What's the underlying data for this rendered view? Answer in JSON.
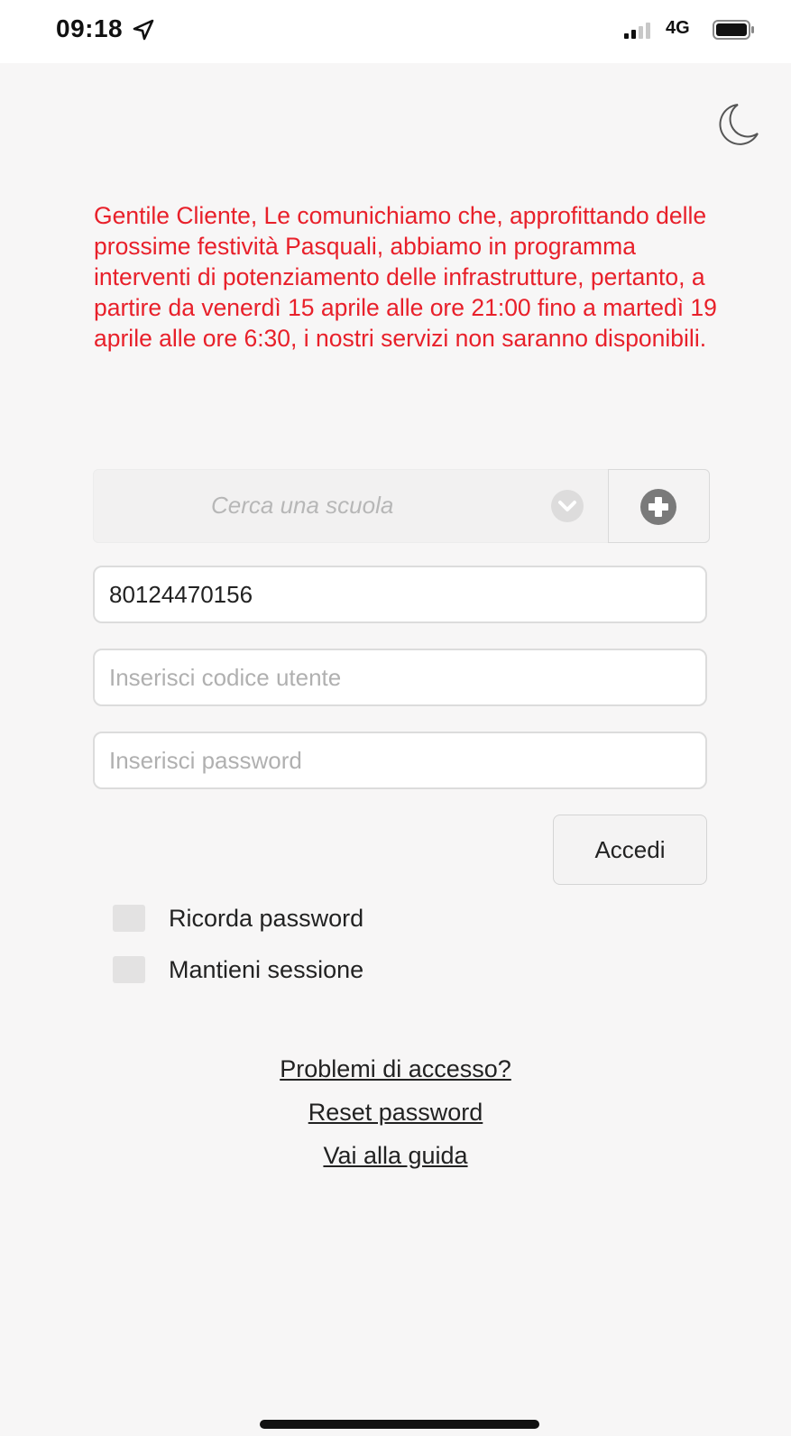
{
  "status_bar": {
    "time": "09:18",
    "network": "4G",
    "icons": [
      "location-arrow-icon",
      "signal-bars-icon",
      "battery-icon"
    ]
  },
  "header": {
    "night_mode_icon": "moon-icon"
  },
  "notice": {
    "text": "Gentile Cliente, Le comunichiamo che, approfittando delle prossime festività Pasquali, abbiamo in programma interventi di potenziamento delle infrastrutture, pertanto, a partire da venerdì 15 aprile alle ore 21:00 fino a martedì 19 aprile alle ore 6:30, i nostri servizi non saranno disponibili.",
    "color": "#e8202a"
  },
  "school_search": {
    "placeholder": "Cerca una scuola",
    "dropdown_icon": "chevron-down-icon",
    "add_icon": "plus-circle-icon"
  },
  "form": {
    "school_code_value": "80124470156",
    "user_placeholder": "Inserisci codice utente",
    "password_placeholder": "Inserisci password",
    "login_label": "Accedi",
    "remember_label": "Ricorda password",
    "keep_session_label": "Mantieni sessione"
  },
  "links": {
    "access_problems": "Problemi di accesso?",
    "reset_password": "Reset password",
    "guide": "Vai alla guida"
  }
}
